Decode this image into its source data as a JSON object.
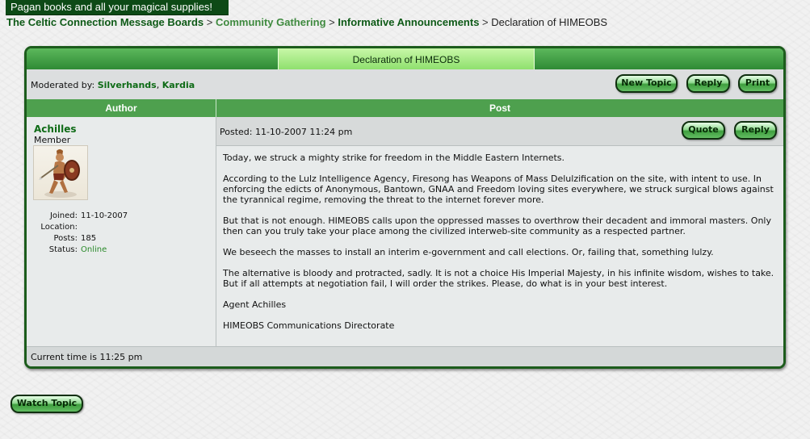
{
  "banner": {
    "text": "Pagan books and all your magical supplies!"
  },
  "breadcrumb": {
    "home": "The Celtic Connection Message Boards",
    "forum": "Community Gathering",
    "subforum": "Informative Announcements",
    "sep": ">",
    "current": "Declaration of HIMEOBS"
  },
  "topic": {
    "title": "Declaration of HIMEOBS",
    "moderated_by_label": "Moderated by:",
    "moderators": [
      "Silverhands",
      "Kardia"
    ],
    "buttons": {
      "new_topic": "New Topic",
      "reply": "Reply",
      "print": "Print"
    }
  },
  "columns": {
    "author": "Author",
    "post": "Post"
  },
  "post": {
    "author": {
      "name": "Achilles",
      "rank": "Member",
      "joined_label": "Joined:",
      "joined": "11-10-2007",
      "location_label": "Location:",
      "location": "",
      "posts_label": "Posts:",
      "posts": "185",
      "status_label": "Status:",
      "status": "Online"
    },
    "posted": "Posted: 11-10-2007 11:24 pm",
    "buttons": {
      "quote": "Quote",
      "reply": "Reply"
    },
    "paragraphs": [
      "Today, we struck a mighty strike for freedom in the Middle Eastern Internets.",
      "According to the Lulz Intelligence Agency, Firesong has Weapons of Mass Delulzification on the site, with intent to use. In enforcing the edicts of Anonymous, Bantown, GNAA and Freedom loving sites everywhere, we struck surgical blows against the tyrannical regime, removing the threat to the internet forever more.",
      "But that is not enough.  HIMEOBS calls upon the oppressed masses to overthrow their decadent and immoral masters. Only then can you truly take your place among the civilized interweb-site community as a respected partner.",
      "We beseech the masses to install an interim e-government and call elections.  Or, failing that, something lulzy.",
      "The alternative is bloody and protracted, sadly.  It is not a choice His Imperial Majesty, in his infinite wisdom, wishes to take.  But if all attempts at negotiation fail, I will order the strikes.  Please, do what is in your best interest.",
      "Agent Achilles",
      "HIMEOBS Communications Directorate"
    ]
  },
  "footer": {
    "current_time": "Current time is 11:25 pm"
  },
  "watch_topic": "Watch Topic"
}
